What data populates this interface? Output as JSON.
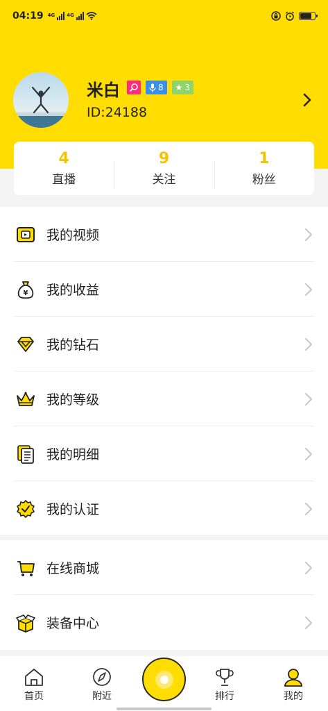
{
  "status_bar": {
    "time": "04:19",
    "network_1": "4G",
    "network_2": "4G",
    "battery_level": 0.8
  },
  "profile": {
    "name": "米白",
    "id_text": "ID:24188",
    "badges": [
      {
        "icon": "search-heart-icon",
        "color": "#ff2d7c",
        "text": ""
      },
      {
        "icon": "microphone-icon",
        "color": "#3a8fe8",
        "text": "8"
      },
      {
        "icon": "star-icon",
        "color": "#8fd46a",
        "text": "3"
      }
    ]
  },
  "stats": [
    {
      "value": "4",
      "label": "直播"
    },
    {
      "value": "9",
      "label": "关注"
    },
    {
      "value": "1",
      "label": "粉丝"
    }
  ],
  "menu_primary": [
    {
      "icon": "video-icon",
      "label": "我的视频"
    },
    {
      "icon": "money-bag-icon",
      "label": "我的收益"
    },
    {
      "icon": "diamond-icon",
      "label": "我的钻石"
    },
    {
      "icon": "crown-icon",
      "label": "我的等级"
    },
    {
      "icon": "list-detail-icon",
      "label": "我的明细"
    },
    {
      "icon": "verified-badge-icon",
      "label": "我的认证"
    }
  ],
  "menu_secondary": [
    {
      "icon": "shopping-cart-icon",
      "label": "在线商城"
    },
    {
      "icon": "equipment-box-icon",
      "label": "装备中心"
    }
  ],
  "tabs": [
    {
      "icon": "home-icon",
      "label": "首页"
    },
    {
      "icon": "compass-icon",
      "label": "附近"
    },
    {
      "icon": "trophy-icon",
      "label": "排行"
    },
    {
      "icon": "user-icon",
      "label": "我的"
    }
  ],
  "colors": {
    "brand_yellow": "#FFDD00",
    "stat_number": "#f5c400"
  }
}
